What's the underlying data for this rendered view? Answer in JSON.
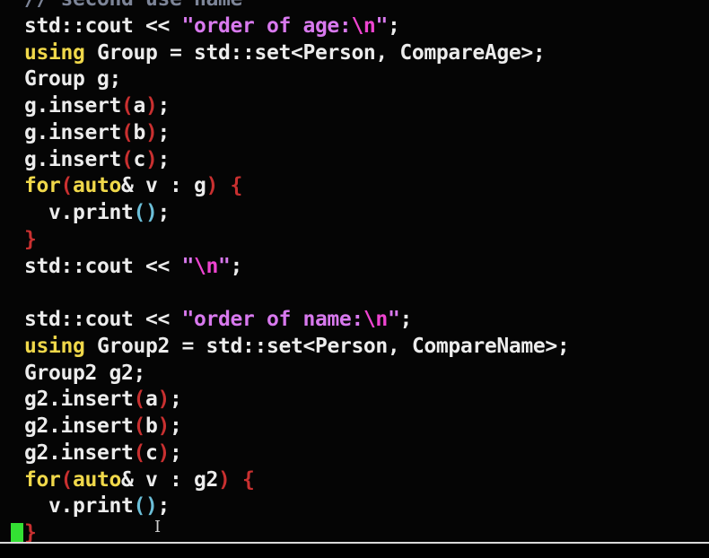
{
  "editor": {
    "colors": {
      "background": "#050505",
      "default": "#ececec",
      "comment": "#7d8598",
      "keyword": "#f0d84a",
      "string": "#d879ee",
      "escape": "#ee44d0",
      "paren": "#6cbfd8",
      "paren_red": "#c93030",
      "cursor": "#33e033",
      "status_rule": "#d9d9d9"
    },
    "lines": [
      [
        {
          "t": "// second use name",
          "c": "comment"
        }
      ],
      [
        {
          "t": "std::cout << ",
          "c": "default"
        },
        {
          "t": "\"order of age:",
          "c": "string"
        },
        {
          "t": "\\n",
          "c": "escape"
        },
        {
          "t": "\"",
          "c": "string"
        },
        {
          "t": ";",
          "c": "default"
        }
      ],
      [
        {
          "t": "using",
          "c": "keyword"
        },
        {
          "t": " Group = std::set<Person, CompareAge>;",
          "c": "default"
        }
      ],
      [
        {
          "t": "Group g;",
          "c": "default"
        }
      ],
      [
        {
          "t": "g.insert",
          "c": "default"
        },
        {
          "t": "(",
          "c": "paren_red"
        },
        {
          "t": "a",
          "c": "default"
        },
        {
          "t": ")",
          "c": "paren_red"
        },
        {
          "t": ";",
          "c": "default"
        }
      ],
      [
        {
          "t": "g.insert",
          "c": "default"
        },
        {
          "t": "(",
          "c": "paren_red"
        },
        {
          "t": "b",
          "c": "default"
        },
        {
          "t": ")",
          "c": "paren_red"
        },
        {
          "t": ";",
          "c": "default"
        }
      ],
      [
        {
          "t": "g.insert",
          "c": "default"
        },
        {
          "t": "(",
          "c": "paren_red"
        },
        {
          "t": "c",
          "c": "default"
        },
        {
          "t": ")",
          "c": "paren_red"
        },
        {
          "t": ";",
          "c": "default"
        }
      ],
      [
        {
          "t": "for",
          "c": "keyword"
        },
        {
          "t": "(",
          "c": "paren_red"
        },
        {
          "t": "auto",
          "c": "keyword"
        },
        {
          "t": "& v : g",
          "c": "default"
        },
        {
          "t": ")",
          "c": "paren_red"
        },
        {
          "t": " ",
          "c": "default"
        },
        {
          "t": "{",
          "c": "paren_red"
        }
      ],
      [
        {
          "t": "  v.print",
          "c": "default"
        },
        {
          "t": "()",
          "c": "paren"
        },
        {
          "t": ";",
          "c": "default"
        }
      ],
      [
        {
          "t": "}",
          "c": "paren_red"
        }
      ],
      [
        {
          "t": "std::cout << ",
          "c": "default"
        },
        {
          "t": "\"",
          "c": "string"
        },
        {
          "t": "\\n",
          "c": "escape"
        },
        {
          "t": "\"",
          "c": "string"
        },
        {
          "t": ";",
          "c": "default"
        }
      ],
      [
        {
          "t": "",
          "c": "default"
        }
      ],
      [
        {
          "t": "std::cout << ",
          "c": "default"
        },
        {
          "t": "\"order of name:",
          "c": "string"
        },
        {
          "t": "\\n",
          "c": "escape"
        },
        {
          "t": "\"",
          "c": "string"
        },
        {
          "t": ";",
          "c": "default"
        }
      ],
      [
        {
          "t": "using",
          "c": "keyword"
        },
        {
          "t": " Group2 = std::set<Person, CompareName>;",
          "c": "default"
        }
      ],
      [
        {
          "t": "Group2 g2;",
          "c": "default"
        }
      ],
      [
        {
          "t": "g2.insert",
          "c": "default"
        },
        {
          "t": "(",
          "c": "paren_red"
        },
        {
          "t": "a",
          "c": "default"
        },
        {
          "t": ")",
          "c": "paren_red"
        },
        {
          "t": ";",
          "c": "default"
        }
      ],
      [
        {
          "t": "g2.insert",
          "c": "default"
        },
        {
          "t": "(",
          "c": "paren_red"
        },
        {
          "t": "b",
          "c": "default"
        },
        {
          "t": ")",
          "c": "paren_red"
        },
        {
          "t": ";",
          "c": "default"
        }
      ],
      [
        {
          "t": "g2.insert",
          "c": "default"
        },
        {
          "t": "(",
          "c": "paren_red"
        },
        {
          "t": "c",
          "c": "default"
        },
        {
          "t": ")",
          "c": "paren_red"
        },
        {
          "t": ";",
          "c": "default"
        }
      ],
      [
        {
          "t": "for",
          "c": "keyword"
        },
        {
          "t": "(",
          "c": "paren_red"
        },
        {
          "t": "auto",
          "c": "keyword"
        },
        {
          "t": "& v : g2",
          "c": "default"
        },
        {
          "t": ")",
          "c": "paren_red"
        },
        {
          "t": " ",
          "c": "default"
        },
        {
          "t": "{",
          "c": "paren_red"
        }
      ],
      [
        {
          "t": "  v.print",
          "c": "default"
        },
        {
          "t": "()",
          "c": "paren"
        },
        {
          "t": ";",
          "c": "default"
        }
      ],
      [
        {
          "t": "}",
          "c": "paren_red"
        }
      ]
    ],
    "mouse_cursor_icon": "text-ibeam-icon",
    "mouse_cursor_glyph": "I"
  }
}
